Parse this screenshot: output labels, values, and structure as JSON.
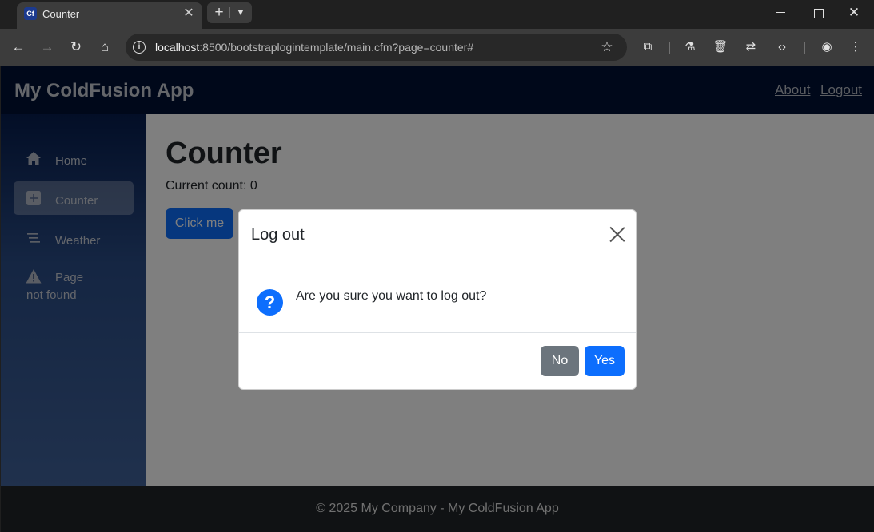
{
  "browser": {
    "tab_title": "Counter",
    "tab_favicon_text": "Cf",
    "url_host": "localhost",
    "url_rest": ":8500/bootstraplogintemplate/main.cfm?page=counter#"
  },
  "app": {
    "brand": "My ColdFusion App",
    "nav": {
      "about": "About",
      "logout": "Logout"
    },
    "sidebar": {
      "items": [
        {
          "label": "Home",
          "icon": "home-icon",
          "active": false
        },
        {
          "label": "Counter",
          "icon": "plus-square-icon",
          "active": true
        },
        {
          "label": "Weather",
          "icon": "list-icon",
          "active": false
        },
        {
          "label": "Page not found",
          "icon": "warning-icon",
          "active": false
        }
      ]
    },
    "main": {
      "title": "Counter",
      "count_text": "Current count: 0",
      "button_label": "Click me"
    },
    "footer": "© 2025 My Company - My ColdFusion App"
  },
  "modal": {
    "title": "Log out",
    "message": "Are you sure you want to log out?",
    "no_label": "No",
    "yes_label": "Yes",
    "icon": "question-circle-icon"
  },
  "colors": {
    "primary": "#0d6efd",
    "secondary": "#6c757d",
    "header_bg": "#001034",
    "footer_bg": "#212529"
  }
}
